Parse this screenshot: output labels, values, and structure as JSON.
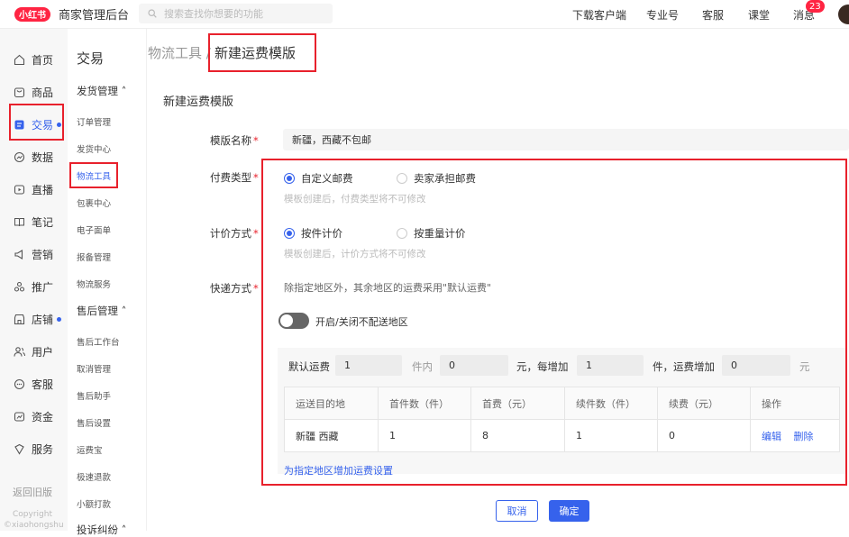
{
  "topbar": {
    "logo_text": "小红书",
    "app_title": "商家管理后台",
    "search_placeholder": "搜索查找你想要的功能",
    "nav": [
      "下载客户端",
      "专业号",
      "客服",
      "课堂",
      "消息"
    ],
    "message_count": "23"
  },
  "sidebar": {
    "items": [
      {
        "label": "首页",
        "icon": "home-icon"
      },
      {
        "label": "商品",
        "icon": "bag-icon"
      },
      {
        "label": "交易",
        "icon": "orders-icon",
        "active": true
      },
      {
        "label": "数据",
        "icon": "chart-icon"
      },
      {
        "label": "直播",
        "icon": "live-icon"
      },
      {
        "label": "笔记",
        "icon": "book-icon"
      },
      {
        "label": "营销",
        "icon": "megaphone-icon"
      },
      {
        "label": "推广",
        "icon": "promote-icon"
      },
      {
        "label": "店铺",
        "icon": "shop-icon"
      },
      {
        "label": "用户",
        "icon": "users-icon"
      },
      {
        "label": "客服",
        "icon": "chat-icon"
      },
      {
        "label": "资金",
        "icon": "wallet-icon"
      },
      {
        "label": "服务",
        "icon": "shield-icon"
      }
    ],
    "back_old": "返回旧版",
    "copyright": "Copyright",
    "copyright_sub": "©xiaohongshu"
  },
  "subnav": {
    "title": "交易",
    "group1": "发货管理",
    "group1_items": [
      "订单管理",
      "发货中心",
      "物流工具",
      "包裹中心",
      "电子面单",
      "报备管理",
      "物流服务"
    ],
    "group2": "售后管理",
    "group2_items": [
      "售后工作台",
      "取消管理",
      "售后助手",
      "售后设置",
      "运费宝",
      "极速退款",
      "小额打款"
    ],
    "group3": "投诉纠纷"
  },
  "breadcrumb": {
    "parent": "物流工具 /",
    "current": "新建运费模版"
  },
  "form": {
    "section_title": "新建运费模版",
    "name_label": "模版名称",
    "name_value": "新疆，西藏不包邮",
    "pay_label": "付费类型",
    "pay_opt1": "自定义邮费",
    "pay_opt2": "卖家承担邮费",
    "pay_hint": "模板创建后，付费类型将不可修改",
    "calc_label": "计价方式",
    "calc_opt1": "按件计价",
    "calc_opt2": "按重量计价",
    "calc_hint": "模板创建后，计价方式将不可修改",
    "express_label": "快递方式",
    "express_desc": "除指定地区外，其余地区的运费采用\"默认运费\"",
    "toggle_label": "开启/关闭不配送地区",
    "default_fee": {
      "label": "默认运费",
      "first_qty": "1",
      "unit_in": "件内",
      "first_fee": "0",
      "yuan_per": "元，每增加",
      "add_qty": "1",
      "unit_add": "件，运费增加",
      "add_fee": "0",
      "yuan": "元"
    },
    "table": {
      "headers": [
        "运送目的地",
        "首件数（件）",
        "首费（元）",
        "续件数（件）",
        "续费（元）",
        "操作"
      ],
      "rows": [
        {
          "dest": "新疆 西藏",
          "first_qty": "1",
          "first_fee": "8",
          "add_qty": "1",
          "add_fee": "0",
          "edit": "编辑",
          "delete": "删除"
        }
      ]
    },
    "add_region": "为指定地区增加运费设置"
  },
  "buttons": {
    "cancel": "取消",
    "ok": "确定"
  },
  "colors": {
    "accent": "#3662ec",
    "brand": "#ff2442",
    "highlight": "#e8212c"
  }
}
